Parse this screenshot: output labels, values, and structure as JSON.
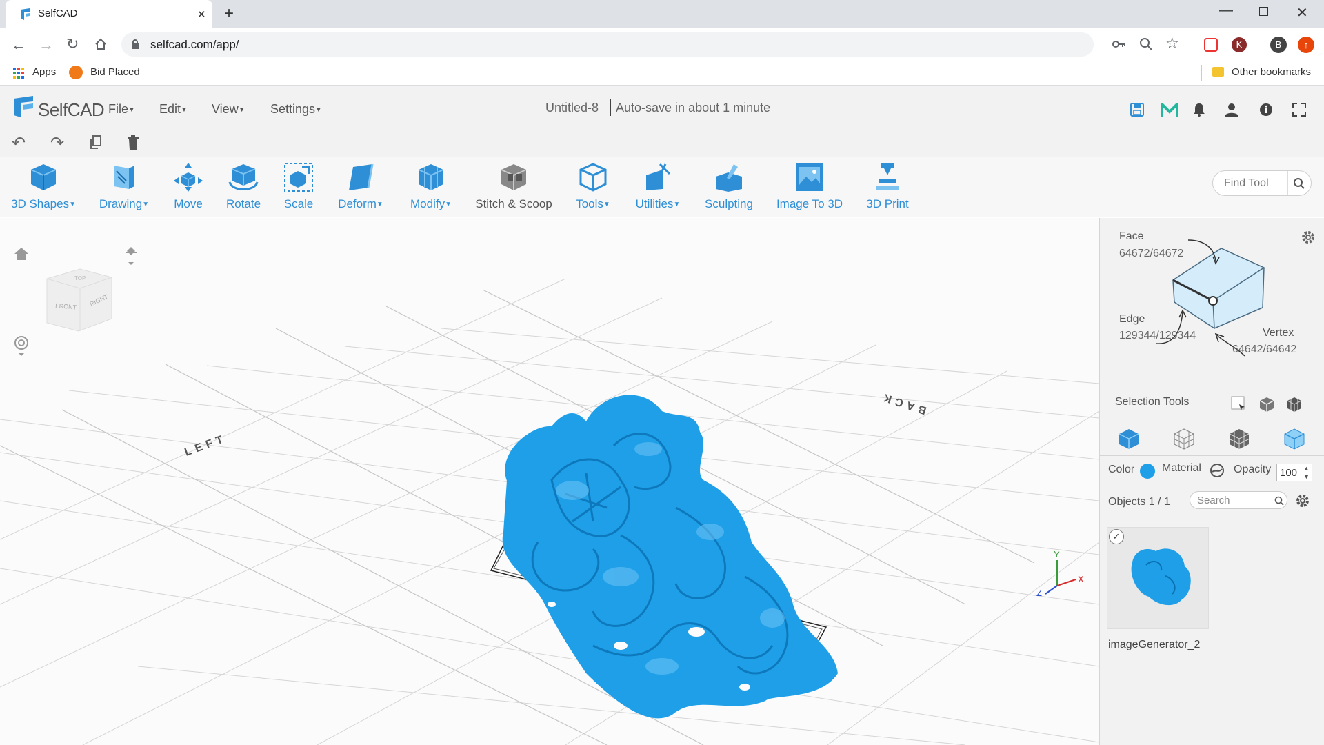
{
  "browser": {
    "tab_title": "SelfCAD",
    "url": "selfcad.com/app/",
    "bookmarks": [
      "Apps",
      "Bid Placed"
    ],
    "other_bookmarks": "Other bookmarks",
    "profile_initials": [
      "K",
      "B"
    ]
  },
  "app": {
    "logo": "SelfCAD",
    "menus": [
      "File",
      "Edit",
      "View",
      "Settings"
    ],
    "doc_title": "Untitled-8",
    "autosave": "Auto-save in about 1 minute",
    "tools": [
      {
        "label": "3D Shapes",
        "dropdown": true
      },
      {
        "label": "Drawing",
        "dropdown": true
      },
      {
        "label": "Move",
        "dropdown": false
      },
      {
        "label": "Rotate",
        "dropdown": false
      },
      {
        "label": "Scale",
        "dropdown": false
      },
      {
        "label": "Deform",
        "dropdown": true
      },
      {
        "label": "Modify",
        "dropdown": true
      },
      {
        "label": "Stitch & Scoop",
        "dropdown": false
      },
      {
        "label": "Tools",
        "dropdown": true
      },
      {
        "label": "Utilities",
        "dropdown": true
      },
      {
        "label": "Sculpting",
        "dropdown": false
      },
      {
        "label": "Image To 3D",
        "dropdown": false
      },
      {
        "label": "3D Print",
        "dropdown": false
      }
    ],
    "find_tool_placeholder": "Find Tool"
  },
  "viewport": {
    "cube_labels": {
      "front": "FRONT",
      "right": "RIGHT",
      "top": "TOP"
    },
    "grid_labels": {
      "left": "LEFT",
      "back": "BACK"
    },
    "axis_labels": {
      "x": "X",
      "y": "Y",
      "z": "Z"
    }
  },
  "panel": {
    "face_label": "Face",
    "face_count": "64672/64672",
    "edge_label": "Edge",
    "edge_count": "129344/129344",
    "vertex_label": "Vertex",
    "vertex_count": "64642/64642",
    "selection_tools": "Selection Tools",
    "color_label": "Color",
    "material_label": "Material",
    "opacity_label": "Opacity",
    "opacity_value": "100",
    "objects_label": "Objects 1 / 1",
    "search_placeholder": "Search",
    "object_name": "imageGenerator_2"
  },
  "colors": {
    "accent": "#2e8fd6",
    "model": "#1e9fe8"
  }
}
